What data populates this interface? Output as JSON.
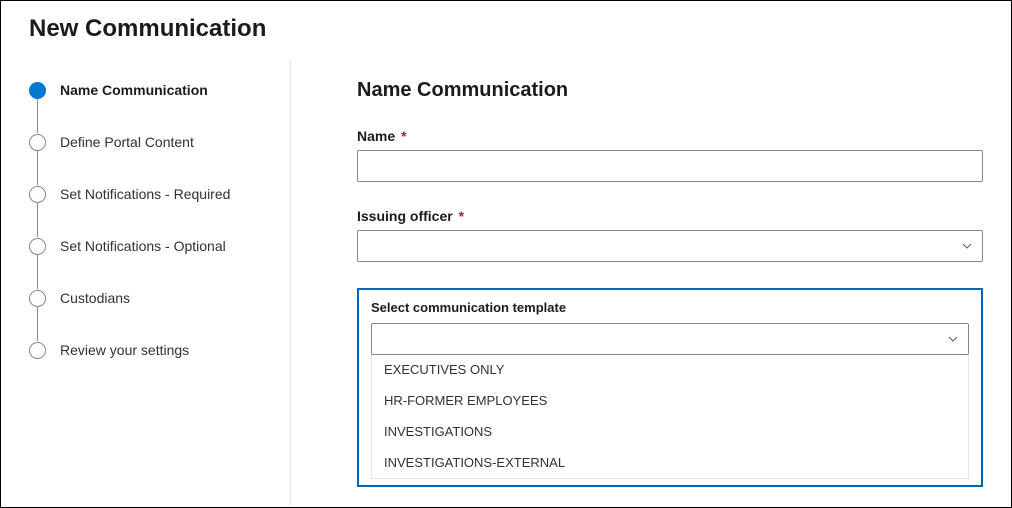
{
  "page_title": "New Communication",
  "steps": [
    {
      "label": "Name Communication",
      "active": true
    },
    {
      "label": "Define Portal Content",
      "active": false
    },
    {
      "label": "Set Notifications - Required",
      "active": false
    },
    {
      "label": "Set Notifications - Optional",
      "active": false
    },
    {
      "label": "Custodians",
      "active": false
    },
    {
      "label": "Review your settings",
      "active": false
    }
  ],
  "main": {
    "section_title": "Name Communication",
    "name_label": "Name",
    "name_value": "",
    "officer_label": "Issuing officer",
    "officer_value": "",
    "template_label": "Select communication template",
    "template_value": "",
    "template_options": [
      "EXECUTIVES ONLY",
      "HR-FORMER EMPLOYEES",
      "INVESTIGATIONS",
      "INVESTIGATIONS-EXTERNAL"
    ],
    "required_mark": "*"
  }
}
